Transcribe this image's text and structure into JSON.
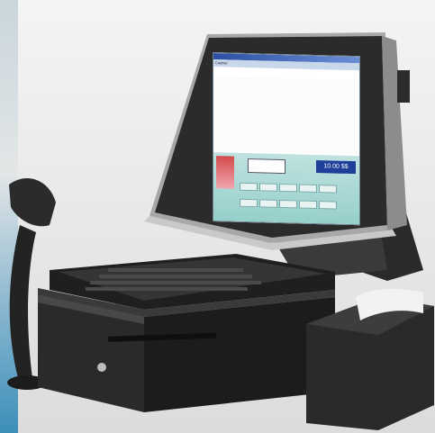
{
  "scene": {
    "background_color": "#e7e7e7",
    "objects": [
      "pos-monitor-icon",
      "barcode-scanner-icon",
      "keyboard-icon",
      "cash-drawer-icon",
      "receipt-printer-icon",
      "drawer-lock-icon"
    ]
  },
  "screen_ui": {
    "hdr_left": "Cashier",
    "total": "10.00 $$",
    "colors": {
      "title_bar": "#2c4fa2",
      "panel": "#96cfca",
      "total_box": "#1d3f9a",
      "link_text": "#1a3ab5"
    }
  }
}
